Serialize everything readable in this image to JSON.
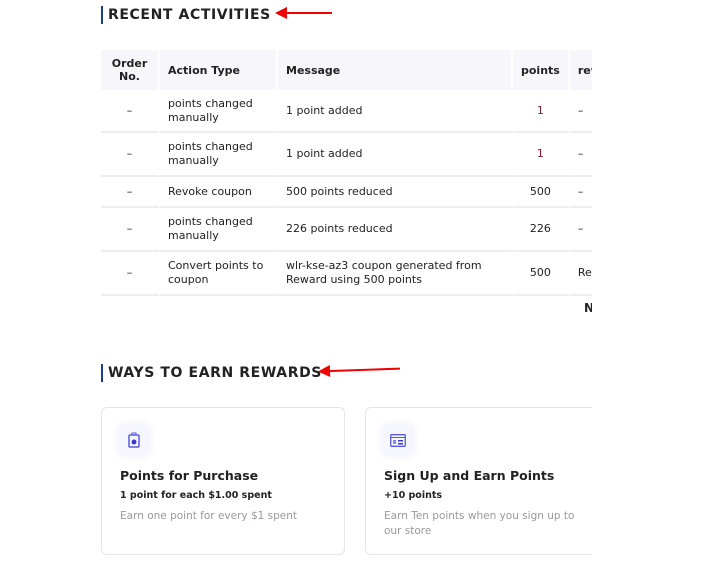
{
  "recent": {
    "title": "RECENT ACTIVITIES",
    "columns": [
      "Order No.",
      "Action Type",
      "Message",
      "points",
      "reward"
    ],
    "rows": [
      [
        "–",
        "points changed manually",
        "1 point added",
        "1",
        "–"
      ],
      [
        "–",
        "points changed manually",
        "1 point added",
        "1",
        "–"
      ],
      [
        "–",
        "Revoke coupon",
        "500 points reduced",
        "500",
        "–"
      ],
      [
        "–",
        "points changed manually",
        "226 points reduced",
        "226",
        "–"
      ],
      [
        "–",
        "Convert points to coupon",
        "wlr-kse-az3 coupon generated from Reward using 500 points",
        "500",
        "Reward"
      ]
    ],
    "footer": "N"
  },
  "earn": {
    "title": "WAYS TO EARN REWARDS",
    "cards": [
      {
        "icon": "shopping-bag-icon",
        "title": "Points for Purchase",
        "subtitle": "1 point for each $1.00 spent",
        "desc": "Earn one point for every $1 spent"
      },
      {
        "icon": "id-card-icon",
        "title": "Sign Up and Earn Points",
        "subtitle": "+10 points",
        "desc": "Earn Ten points when you sign up to our store"
      }
    ]
  },
  "colors": {
    "accent": "#1d3c8f",
    "arrow": "#e00000",
    "icon": "#5b5be0"
  }
}
